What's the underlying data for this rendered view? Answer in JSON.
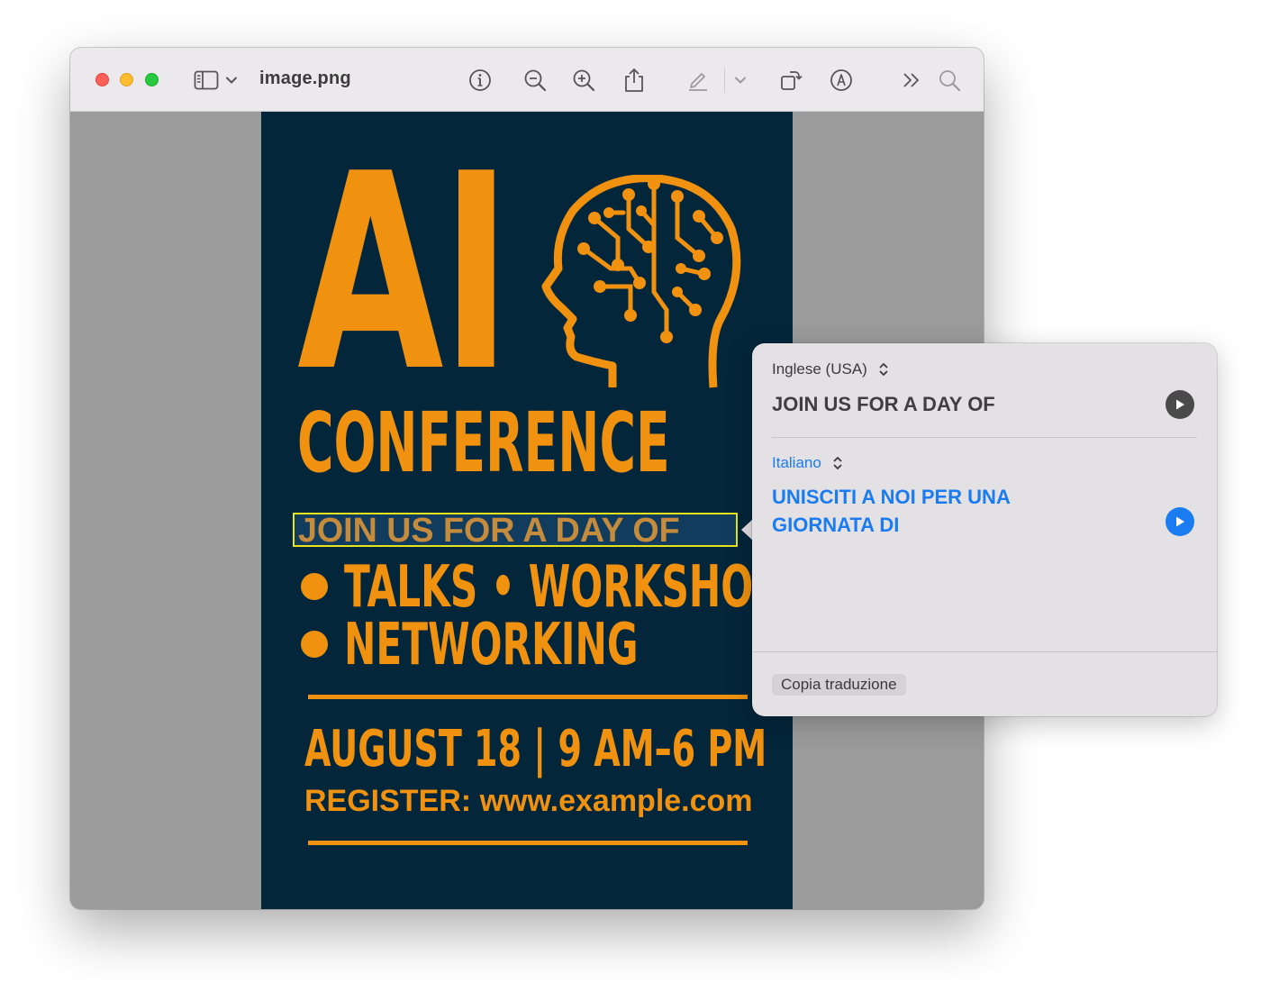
{
  "window": {
    "title": "image.png"
  },
  "toolbar": {
    "icons": [
      "sidebar-icon",
      "chevron-down-icon",
      "info-icon",
      "zoom-out-icon",
      "zoom-in-icon",
      "share-icon",
      "highlight-pen-icon",
      "chevron-down-icon",
      "rotate-icon",
      "markup-icon",
      "more-icon",
      "search-icon"
    ]
  },
  "poster": {
    "title_ai": "AI",
    "title_conference": "CONFERENCE",
    "selected_line": "JOIN US FOR A DAY OF",
    "bullet_1": "TALKS • WORKSHOPS",
    "bullet_2": "NETWORKING",
    "date": "AUGUST 18 | 9 AM–6 PM",
    "register": "REGISTER: www.example.com",
    "colors": {
      "background": "#04263b",
      "accent": "#f0920f",
      "selection_border": "#e6e51c"
    }
  },
  "translation": {
    "source_language": "Inglese (USA)",
    "source_text": "JOIN US FOR A DAY OF",
    "target_language": "Italiano",
    "target_text": "UNISCITI A NOI PER UNA GIORNATA DI",
    "copy_button": "Copia traduzione",
    "colors": {
      "accent": "#1a7cf0"
    }
  }
}
